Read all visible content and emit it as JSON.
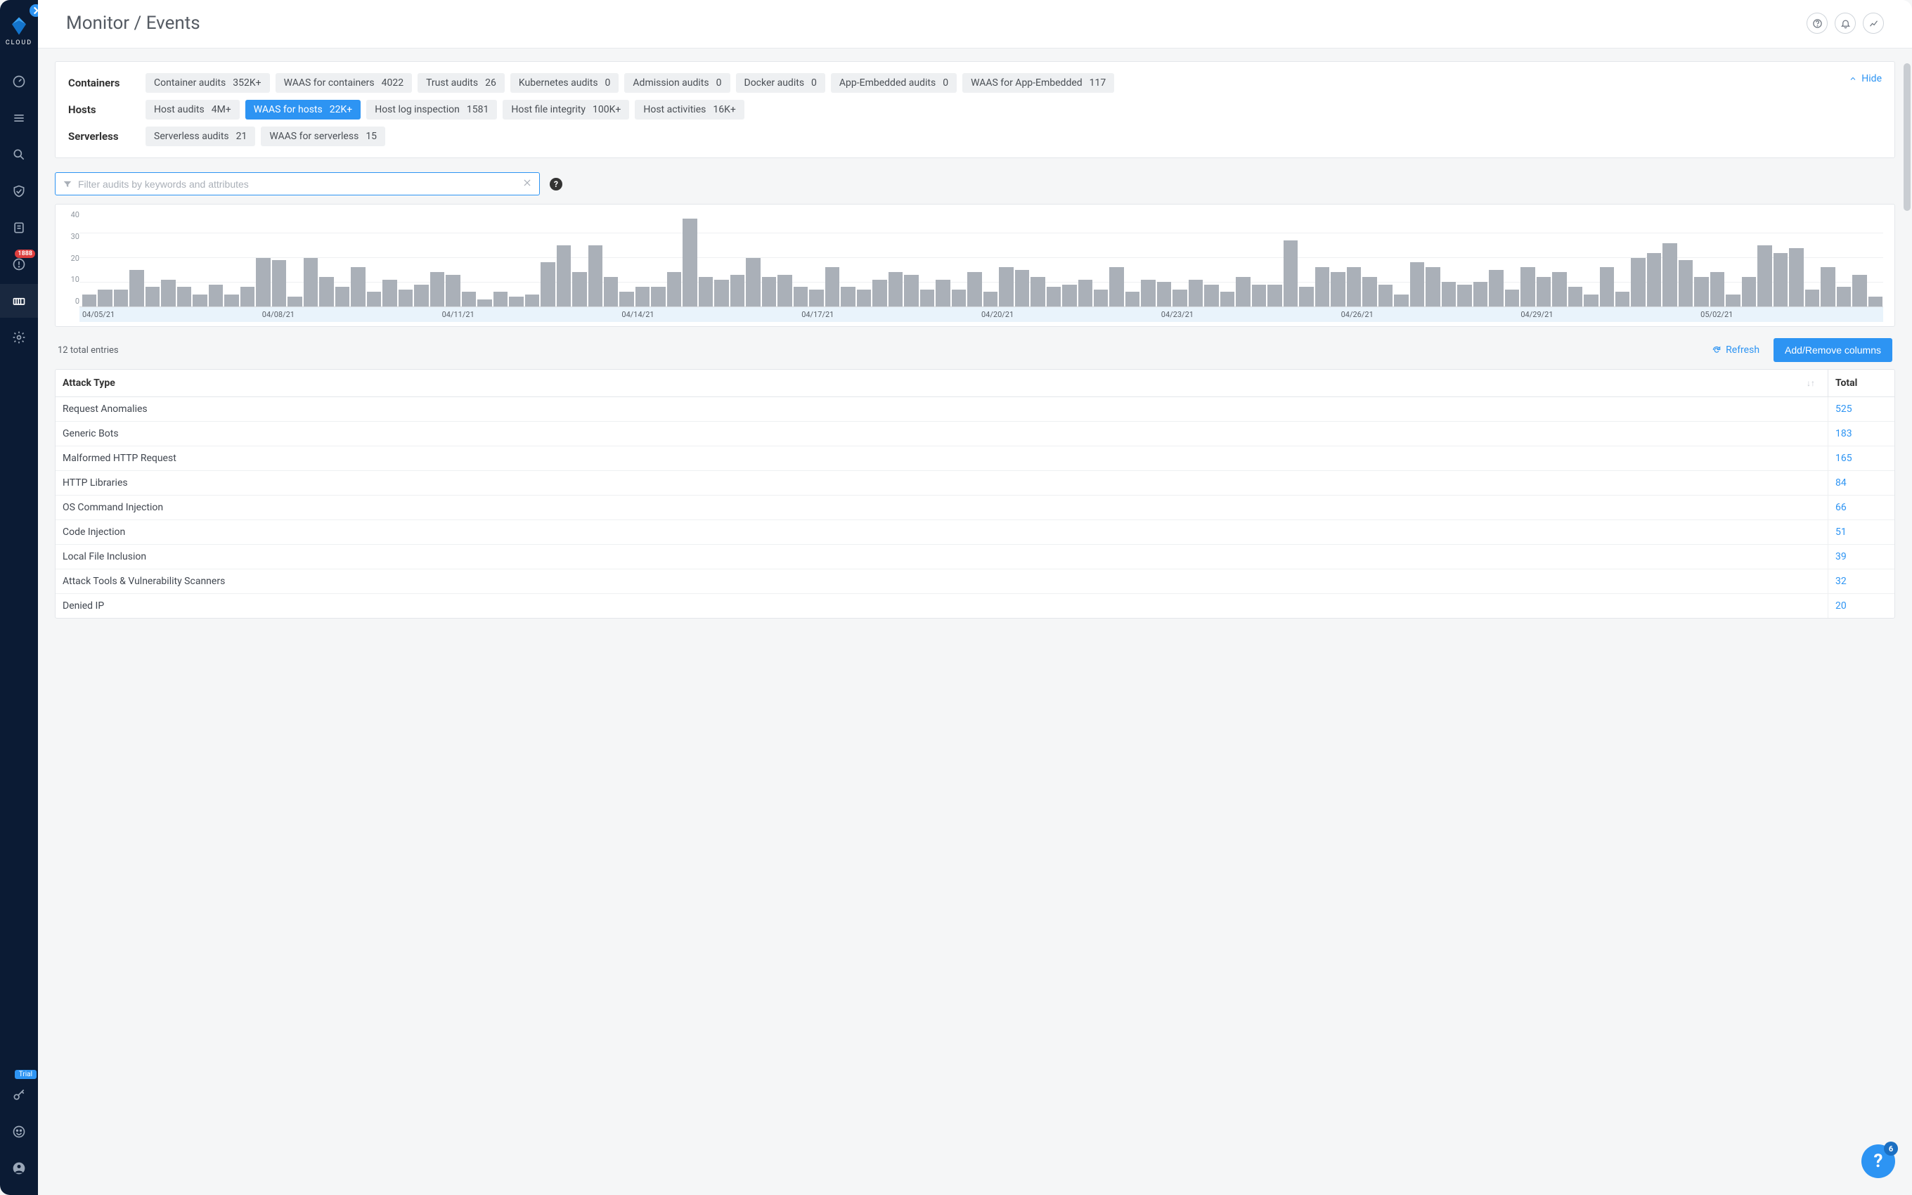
{
  "brand": {
    "name": "CLOUD"
  },
  "sidebar": {
    "alerts_badge": "1888",
    "trial_label": "Trial"
  },
  "header": {
    "title": "Monitor / Events"
  },
  "filters": {
    "hide_label": "Hide",
    "groups": [
      {
        "label": "Containers",
        "chips": [
          {
            "name": "Container audits",
            "count": "352K+"
          },
          {
            "name": "WAAS for containers",
            "count": "4022"
          },
          {
            "name": "Trust audits",
            "count": "26"
          },
          {
            "name": "Kubernetes audits",
            "count": "0"
          },
          {
            "name": "Admission audits",
            "count": "0"
          },
          {
            "name": "Docker audits",
            "count": "0"
          },
          {
            "name": "App-Embedded audits",
            "count": "0"
          },
          {
            "name": "WAAS for App-Embedded",
            "count": "117"
          }
        ]
      },
      {
        "label": "Hosts",
        "chips": [
          {
            "name": "Host audits",
            "count": "4M+"
          },
          {
            "name": "WAAS for hosts",
            "count": "22K+",
            "active": true
          },
          {
            "name": "Host log inspection",
            "count": "1581"
          },
          {
            "name": "Host file integrity",
            "count": "100K+"
          },
          {
            "name": "Host activities",
            "count": "16K+"
          }
        ]
      },
      {
        "label": "Serverless",
        "chips": [
          {
            "name": "Serverless audits",
            "count": "21"
          },
          {
            "name": "WAAS for serverless",
            "count": "15"
          }
        ]
      }
    ]
  },
  "search": {
    "placeholder": "Filter audits by keywords and attributes"
  },
  "chart_data": {
    "type": "bar",
    "title": "",
    "xlabel": "",
    "ylabel": "",
    "ylim": [
      0,
      40
    ],
    "y_ticks": [
      "40",
      "30",
      "20",
      "10",
      "0"
    ],
    "x_ticks": [
      "04/05/21",
      "04/08/21",
      "04/11/21",
      "04/14/21",
      "04/17/21",
      "04/20/21",
      "04/23/21",
      "04/26/21",
      "04/29/21",
      "05/02/21"
    ],
    "values": [
      5,
      7,
      7,
      15,
      8,
      11,
      8,
      5,
      9,
      5,
      8,
      20,
      19,
      4,
      20,
      12,
      8,
      16,
      6,
      11,
      7,
      9,
      14,
      13,
      6,
      3,
      6,
      4,
      5,
      18,
      25,
      14,
      25,
      12,
      6,
      8,
      8,
      14,
      36,
      12,
      11,
      13,
      20,
      12,
      13,
      8,
      7,
      16,
      8,
      7,
      11,
      14,
      13,
      7,
      11,
      7,
      14,
      6,
      16,
      15,
      12,
      8,
      9,
      11,
      7,
      16,
      6,
      11,
      10,
      7,
      11,
      9,
      6,
      12,
      9,
      9,
      27,
      8,
      16,
      14,
      16,
      12,
      9,
      5,
      18,
      16,
      10,
      9,
      10,
      15,
      7,
      16,
      12,
      14,
      8,
      5,
      16,
      6,
      20,
      22,
      26,
      19,
      12,
      14,
      5,
      12,
      25,
      22,
      24,
      7,
      16,
      8,
      13,
      4
    ]
  },
  "table": {
    "entries_text": "12 total entries",
    "refresh_label": "Refresh",
    "columns_button": "Add/Remove columns",
    "headers": {
      "attack": "Attack Type",
      "total": "Total"
    },
    "rows": [
      {
        "attack": "Request Anomalies",
        "total": "525"
      },
      {
        "attack": "Generic Bots",
        "total": "183"
      },
      {
        "attack": "Malformed HTTP Request",
        "total": "165"
      },
      {
        "attack": "HTTP Libraries",
        "total": "84"
      },
      {
        "attack": "OS Command Injection",
        "total": "66"
      },
      {
        "attack": "Code Injection",
        "total": "51"
      },
      {
        "attack": "Local File Inclusion",
        "total": "39"
      },
      {
        "attack": "Attack Tools & Vulnerability Scanners",
        "total": "32"
      },
      {
        "attack": "Denied IP",
        "total": "20"
      }
    ]
  },
  "float_help": {
    "badge": "6"
  }
}
